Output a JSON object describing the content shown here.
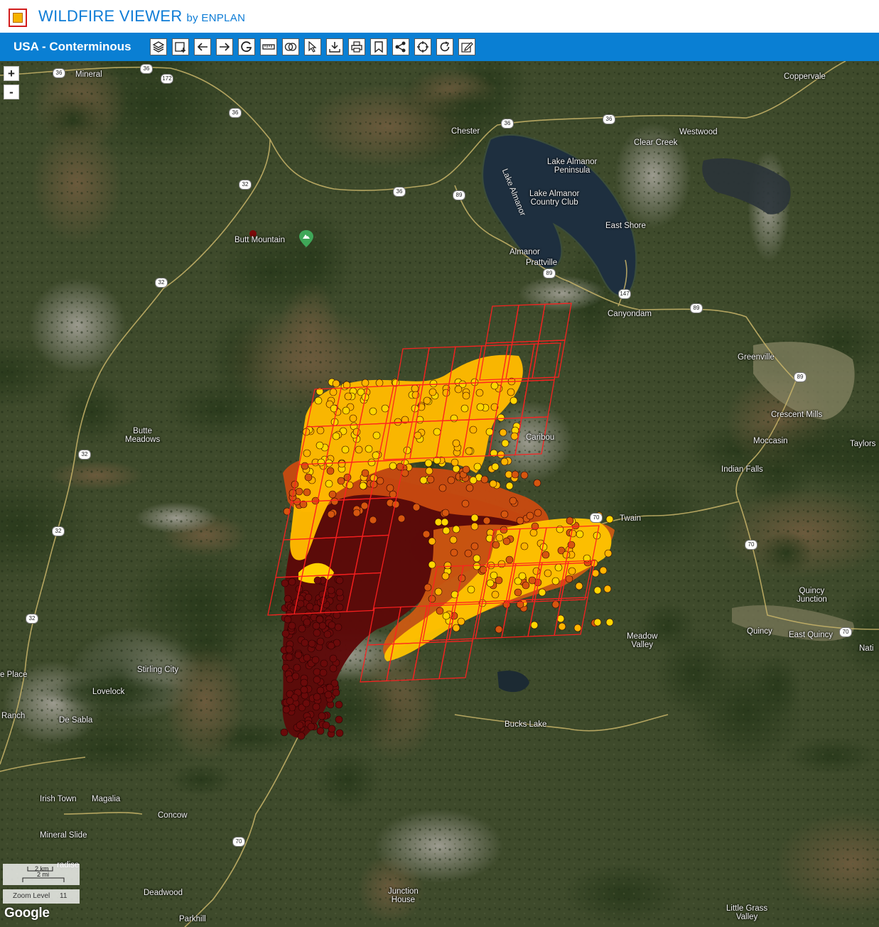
{
  "app": {
    "title": "WILDFIRE VIEWER",
    "by": "by ENPLAN"
  },
  "toolbar": {
    "region": "USA - Conterminous",
    "tools": [
      "layers-icon",
      "add-area-icon",
      "back-arrow-icon",
      "forward-arrow-icon",
      "google-g-icon",
      "measure-ruler-icon",
      "compare-circles-icon",
      "select-pointer-icon",
      "download-icon",
      "print-icon",
      "bookmark-icon",
      "share-icon",
      "locate-crosshair-icon",
      "refresh-icon",
      "edit-icon"
    ]
  },
  "map": {
    "zoom_in": "+",
    "zoom_out": "-",
    "scale_km": "2 km",
    "scale_mi": "2 mi",
    "zoom_level_label": "Zoom Level",
    "zoom_level_value": "11",
    "attribution": "Google",
    "places": [
      {
        "name": "Mineral"
      },
      {
        "name": "Coppervale"
      },
      {
        "name": "Chester"
      },
      {
        "name": "Westwood"
      },
      {
        "name": "Clear Creek"
      },
      {
        "name": "Lake Almanor\nPeninsula"
      },
      {
        "name": "Lake Almanor\nCountry Club"
      },
      {
        "name": "East Shore"
      },
      {
        "name": "Butt Mountain"
      },
      {
        "name": "Almanor"
      },
      {
        "name": "Prattville"
      },
      {
        "name": "Canyondam"
      },
      {
        "name": "Greenville"
      },
      {
        "name": "Crescent Mills"
      },
      {
        "name": "Butte\nMeadows"
      },
      {
        "name": "Caribou"
      },
      {
        "name": "Moccasin"
      },
      {
        "name": "Taylors"
      },
      {
        "name": "Indian Falls"
      },
      {
        "name": "Twain"
      },
      {
        "name": "Quincy\nJunction"
      },
      {
        "name": "Quincy"
      },
      {
        "name": "East Quincy"
      },
      {
        "name": "Meadow\nValley"
      },
      {
        "name": "Nati"
      },
      {
        "name": "Stirling City"
      },
      {
        "name": "Lovelock"
      },
      {
        "name": "e Place"
      },
      {
        "name": "Ranch"
      },
      {
        "name": "De Sabla"
      },
      {
        "name": "Bucks Lake"
      },
      {
        "name": "Irish Town"
      },
      {
        "name": "Magalia"
      },
      {
        "name": "Concow"
      },
      {
        "name": "Mineral Slide"
      },
      {
        "name": "radise"
      },
      {
        "name": "Deadwood"
      },
      {
        "name": "Junction\nHouse"
      },
      {
        "name": "Parkhill"
      },
      {
        "name": "Little Grass\nValley"
      }
    ],
    "road_shields": [
      "36",
      "36",
      "172",
      "36",
      "36",
      "36",
      "36",
      "32",
      "89",
      "89",
      "147",
      "89",
      "89",
      "32",
      "32",
      "32",
      "32",
      "70",
      "70",
      "70",
      "70"
    ],
    "water_label": "Lake Almanor",
    "fire_colors": {
      "oldest": "#6a0a0a",
      "older": "#d5560f",
      "recent": "#ffb400",
      "newest": "#ffd600",
      "grid": "#ff2020"
    }
  }
}
